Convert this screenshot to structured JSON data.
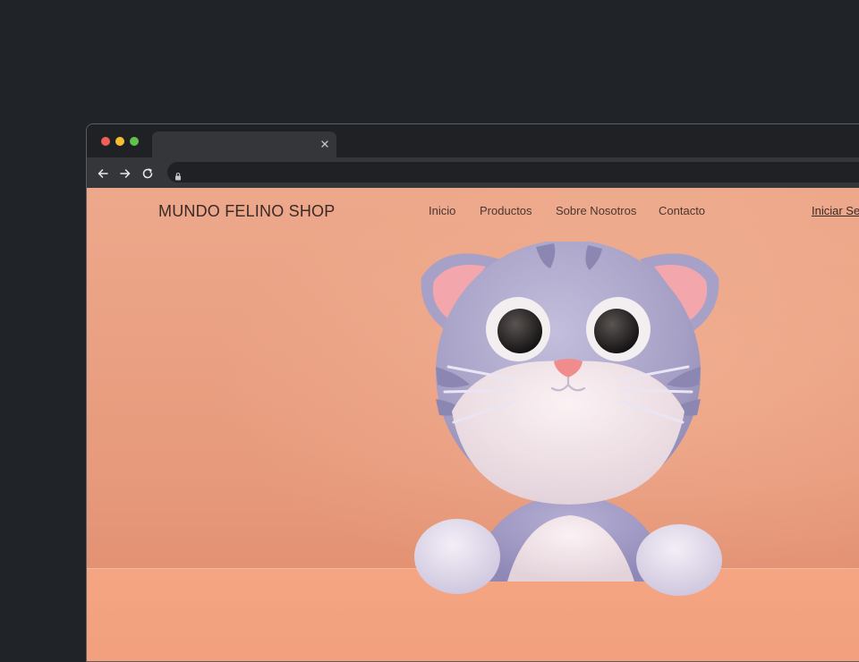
{
  "browser": {
    "tab_title": "",
    "url": "",
    "icons": {
      "close": "close-icon",
      "back": "back-arrow-icon",
      "forward": "forward-arrow-icon",
      "reload": "reload-icon",
      "lock": "lock-icon"
    },
    "window_controls": [
      "close",
      "minimize",
      "maximize"
    ]
  },
  "site": {
    "logo": "MUNDO FELINO SHOP",
    "nav": [
      {
        "label": "Inicio"
      },
      {
        "label": "Productos"
      },
      {
        "label": "Sobre Nosotros"
      },
      {
        "label": "Contacto"
      }
    ],
    "login_label": "Iniciar Se"
  },
  "colors": {
    "page_background": "#eda88b",
    "ledge": "#f4a582",
    "text": "#3a2a27",
    "cat_fur": "#a9a3c8",
    "cat_belly": "#f1e6ea",
    "cat_nose": "#f08c8c"
  }
}
